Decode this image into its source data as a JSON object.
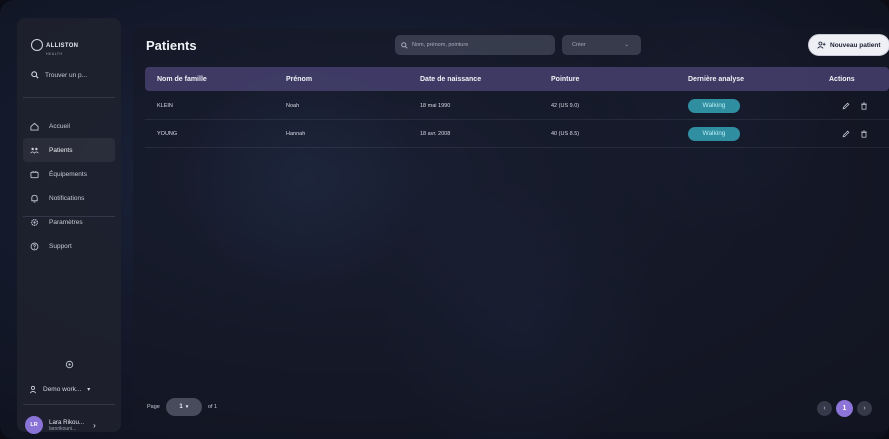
{
  "brand": {
    "name": "ALLISTON",
    "sub": "HEALTH"
  },
  "sidebar": {
    "search_label": "Trouver un p...",
    "items": [
      {
        "label": "Accueil",
        "icon": "home-icon"
      },
      {
        "label": "Patients",
        "icon": "patients-icon"
      },
      {
        "label": "Équipements",
        "icon": "equipment-icon"
      },
      {
        "label": "Notifications",
        "icon": "bell-icon"
      },
      {
        "label": "Paramètres",
        "icon": "gear-icon"
      },
      {
        "label": "Support",
        "icon": "support-icon"
      }
    ],
    "active_index": 1,
    "workspace": "Demo work...",
    "user": {
      "initials": "LR",
      "name": "Lara Rikou...",
      "email": "larorikouni..."
    }
  },
  "header": {
    "title": "Patients",
    "search_placeholder": "Nom, prénom, pointure",
    "select_value": "Créer",
    "new_button": "Nouveau patient"
  },
  "table": {
    "columns": [
      "Nom de famille",
      "Prénom",
      "Date de naissance",
      "Pointure",
      "Dernière analyse",
      "Actions"
    ],
    "rows": [
      {
        "last": "KLEIN",
        "first": "Noah",
        "dob": "18 mai 1990",
        "size": "42 (US 9.0)",
        "analysis": "Walking"
      },
      {
        "last": "YOUNG",
        "first": "Hannah",
        "dob": "18 avr. 2008",
        "size": "40 (US 8.5)",
        "analysis": "Walking"
      }
    ]
  },
  "pagination": {
    "page_label": "Page",
    "page_value": "1",
    "of_label": "of 1",
    "current": "1"
  },
  "colors": {
    "accent": "#8c74d8",
    "badge": "#2f8ea0",
    "header_row": "#4c4678"
  }
}
